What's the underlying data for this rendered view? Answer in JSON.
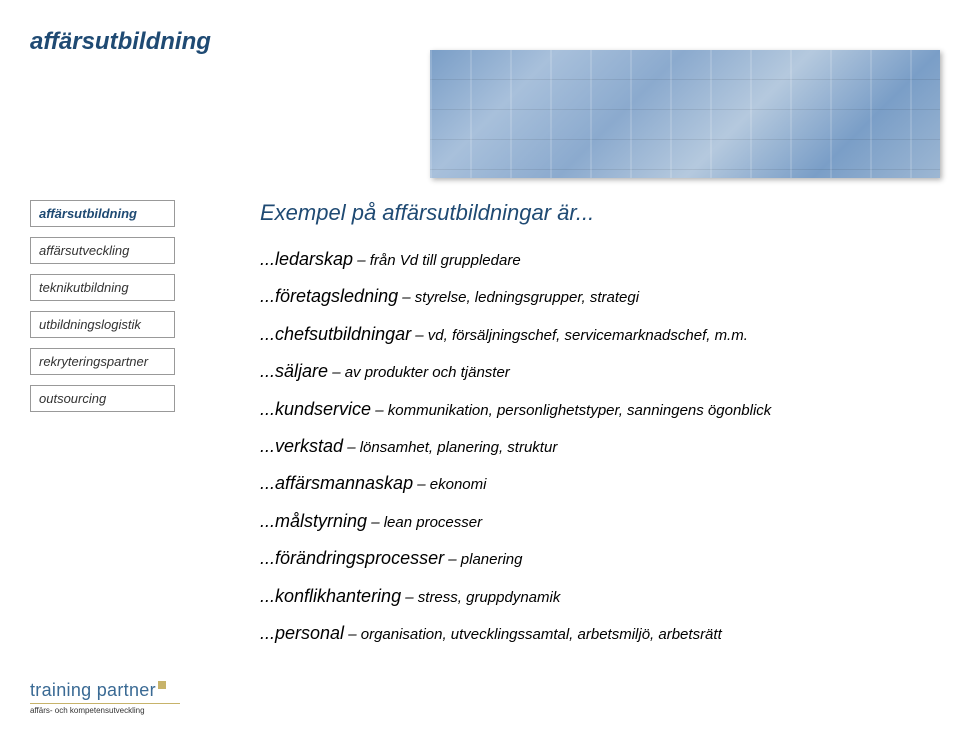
{
  "page_title": "affärsutbildning",
  "sidebar": {
    "items": [
      {
        "label": "affärsutbildning",
        "active": true
      },
      {
        "label": "affärsutveckling",
        "active": false
      },
      {
        "label": "teknikutbildning",
        "active": false
      },
      {
        "label": "utbildningslogistik",
        "active": false
      },
      {
        "label": "rekryteringspartner",
        "active": false
      },
      {
        "label": "outsourcing",
        "active": false
      }
    ]
  },
  "content": {
    "title": "Exempel på affärsutbildningar är...",
    "lines": [
      {
        "term": "...ledarskap",
        "detail": " – från Vd till gruppledare"
      },
      {
        "term": "...företagsledning",
        "detail": " – styrelse, ledningsgrupper, strategi"
      },
      {
        "term": "...chefsutbildningar",
        "detail": " – vd, försäljningschef, servicemarknadschef, m.m."
      },
      {
        "term": "...säljare",
        "detail": " – av produkter och tjänster"
      },
      {
        "term": "...kundservice",
        "detail": " – kommunikation, personlighetstyper, sanningens ögonblick"
      },
      {
        "term": "...verkstad",
        "detail": " – lönsamhet, planering, struktur"
      },
      {
        "term": "...affärsmannaskap",
        "detail": " – ekonomi"
      },
      {
        "term": "...målstyrning",
        "detail": " – lean processer"
      },
      {
        "term": "...förändringsprocesser",
        "detail": " – planering"
      },
      {
        "term": "...konflikhantering",
        "detail": " – stress, gruppdynamik"
      },
      {
        "term": "...personal",
        "detail": " – organisation, utvecklingssamtal, arbetsmiljö, arbetsrätt"
      }
    ]
  },
  "logo": {
    "main": "training partner",
    "sub": "affärs- och kompetensutveckling"
  }
}
